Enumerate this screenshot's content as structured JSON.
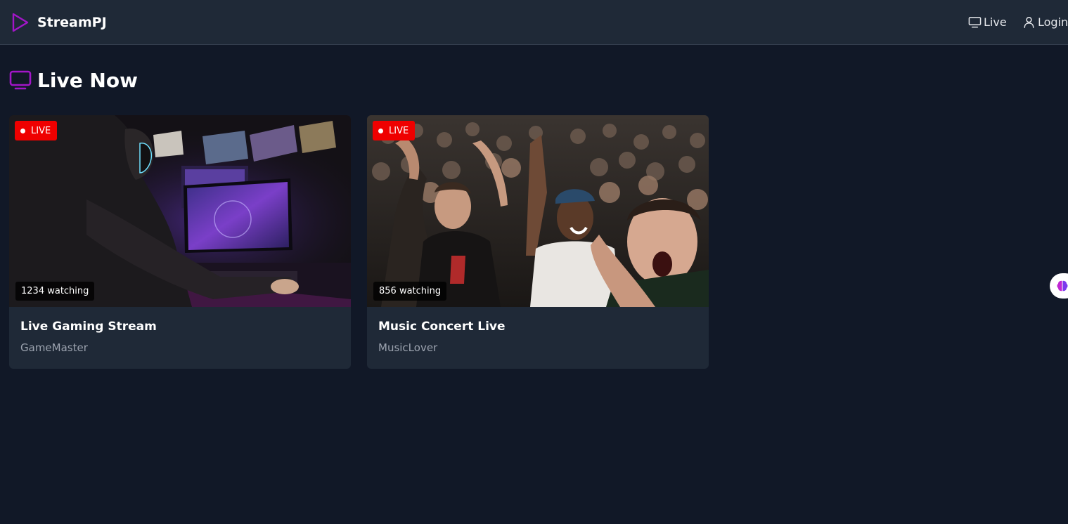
{
  "app": {
    "name": "StreamPJ",
    "accent": "#a216c8",
    "logo_icon": "play-icon"
  },
  "nav": {
    "live": {
      "label": "Live",
      "icon": "monitor-icon"
    },
    "login": {
      "label": "Login",
      "icon": "user-icon"
    }
  },
  "section": {
    "title": "Live Now",
    "icon": "tv-icon"
  },
  "streams": [
    {
      "badge": "LIVE",
      "viewers": "1234 watching",
      "title": "Live Gaming Stream",
      "user": "GameMaster"
    },
    {
      "badge": "LIVE",
      "viewers": "856 watching",
      "title": "Music Concert Live",
      "user": "MusicLover"
    }
  ],
  "colors": {
    "background": "#111827",
    "topbar": "#1f2937",
    "card": "#1f2937",
    "live_badge": "#ef0000",
    "muted_text": "#9ca3af"
  },
  "widget": {
    "icon": "brain-icon"
  }
}
